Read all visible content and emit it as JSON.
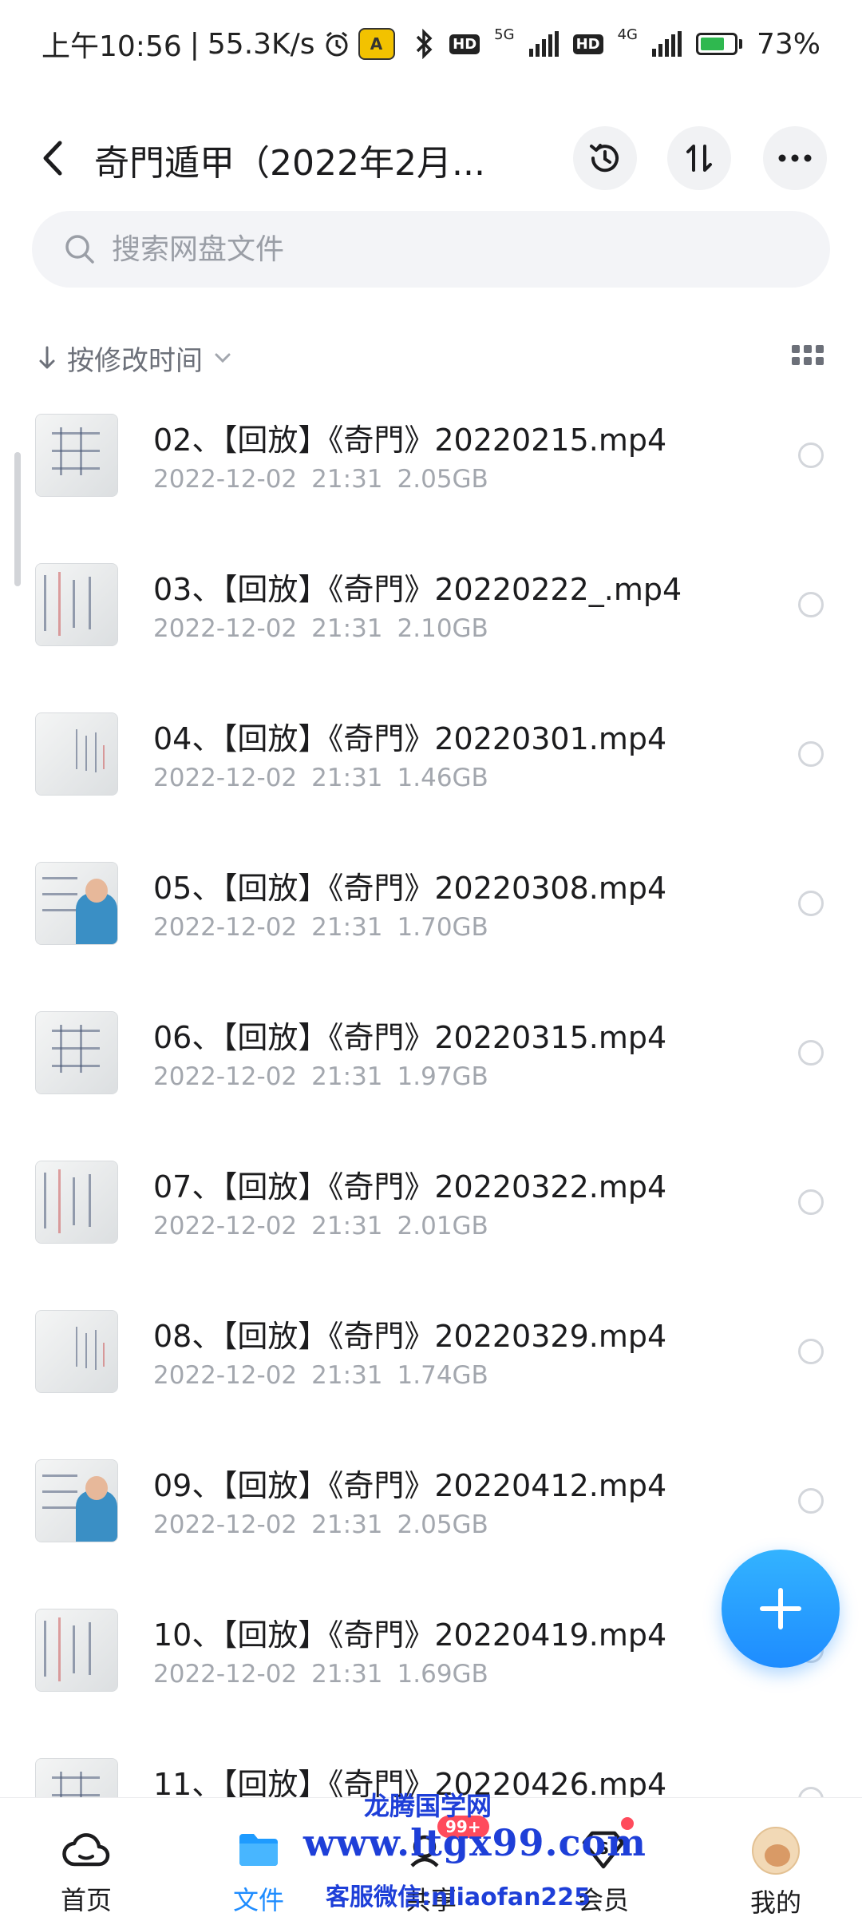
{
  "status_bar": {
    "time": "上午10:56",
    "speed": "55.3K/s",
    "net1": "5G",
    "net2": "4G",
    "hd": "HD",
    "battery": "73%",
    "battery_level": 0.73
  },
  "header": {
    "title": "奇門遁甲（2022年2月..."
  },
  "search": {
    "placeholder": "搜索网盘文件"
  },
  "sort": {
    "label": "按修改时间"
  },
  "files": [
    {
      "name": "02、【回放】《奇門》20220215.mp4",
      "date": "2022-12-02",
      "time": "21:31",
      "size": "2.05GB"
    },
    {
      "name": "03、【回放】《奇門》20220222_.mp4",
      "date": "2022-12-02",
      "time": "21:31",
      "size": "2.10GB"
    },
    {
      "name": "04、【回放】《奇門》20220301.mp4",
      "date": "2022-12-02",
      "time": "21:31",
      "size": "1.46GB"
    },
    {
      "name": "05、【回放】《奇門》20220308.mp4",
      "date": "2022-12-02",
      "time": "21:31",
      "size": "1.70GB"
    },
    {
      "name": "06、【回放】《奇門》20220315.mp4",
      "date": "2022-12-02",
      "time": "21:31",
      "size": "1.97GB"
    },
    {
      "name": "07、【回放】《奇門》20220322.mp4",
      "date": "2022-12-02",
      "time": "21:31",
      "size": "2.01GB"
    },
    {
      "name": "08、【回放】《奇門》20220329.mp4",
      "date": "2022-12-02",
      "time": "21:31",
      "size": "1.74GB"
    },
    {
      "name": "09、【回放】《奇門》20220412.mp4",
      "date": "2022-12-02",
      "time": "21:31",
      "size": "2.05GB"
    },
    {
      "name": "10、【回放】《奇門》20220419.mp4",
      "date": "2022-12-02",
      "time": "21:31",
      "size": "1.69GB"
    },
    {
      "name": "11、【回放】《奇門》20220426.mp4",
      "date": "",
      "time": "",
      "size": ""
    }
  ],
  "nav": {
    "home": "首页",
    "files": "文件",
    "share": "共享",
    "share_badge": "99+",
    "vip": "会员",
    "mine": "我的"
  },
  "watermark": {
    "line1": "龙腾国学网",
    "line2": "www.ltgx99.com",
    "line3": "客服微信:nliaofan225"
  },
  "colors": {
    "accent": "#1e8cff",
    "badge": "#ff4b5c",
    "watermark": "#1e3fd8"
  }
}
